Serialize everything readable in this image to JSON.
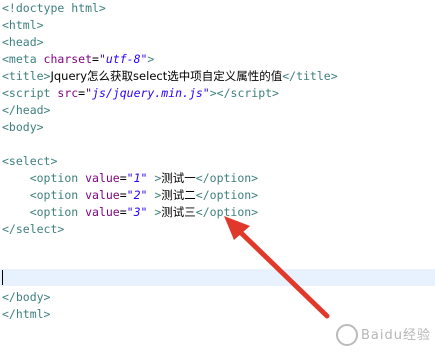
{
  "code": {
    "doctype": "<!doctype html>",
    "html_open": "<html>",
    "head_open": "<head>",
    "meta_open": "<meta ",
    "meta_attr": "charset",
    "meta_eq": "=",
    "meta_val": "\"utf-8\"",
    "meta_close": ">",
    "title_open": "<title>",
    "title_text": "Jquery怎么获取select选中项自定义属性的值",
    "title_close": "</title>",
    "script_open": "<script ",
    "script_attr": "src",
    "script_eq": "=",
    "script_val": "\"js/jquery.min.js\"",
    "script_mid": "></",
    "script_close": "script>",
    "head_close": "</head>",
    "body_open": "<body>",
    "select_open": "<select>",
    "options": [
      {
        "open": "<option ",
        "attr": "value",
        "eq": "=",
        "val": "\"1\"",
        "gt": " >",
        "text": "测试一",
        "close": "</option>"
      },
      {
        "open": "<option ",
        "attr": "value",
        "eq": "=",
        "val": "\"2\"",
        "gt": " >",
        "text": "测试二",
        "close": "</option>"
      },
      {
        "open": "<option ",
        "attr": "value",
        "eq": "=",
        "val": "\"3\"",
        "gt": " >",
        "text": "测试三",
        "close": "</option>"
      }
    ],
    "select_close": "</select>",
    "body_close": "</body>",
    "html_close": "</html>"
  },
  "watermark": "Baidu经验",
  "colors": {
    "tag": "#3f7f7f",
    "attribute": "#7f007f",
    "value": "#2a00ff",
    "current_line": "#e8f2fe",
    "arrow": "#e0392b"
  }
}
